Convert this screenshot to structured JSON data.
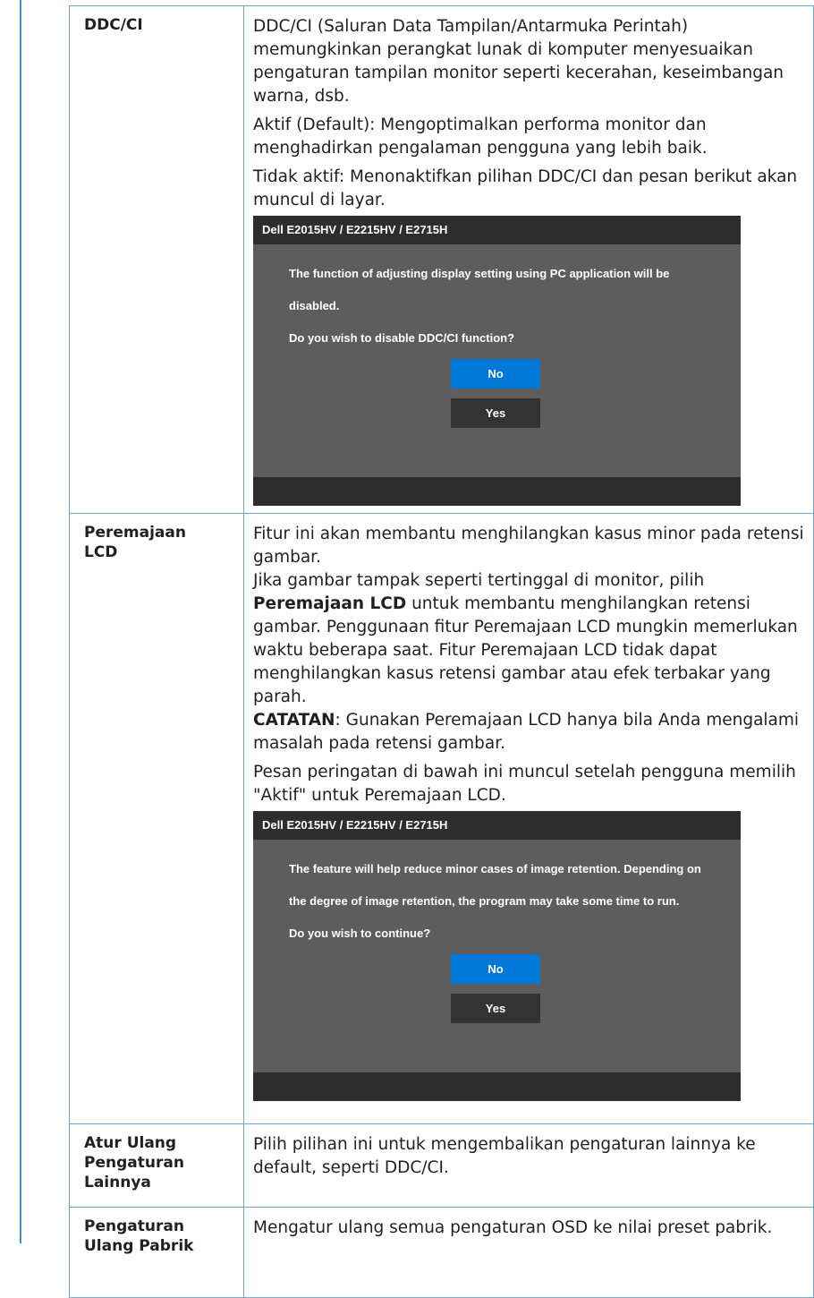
{
  "rows": {
    "ddcci": {
      "label": "DDC/CI",
      "p1": "DDC/CI (Saluran Data Tampilan/Antarmuka Perintah) memungkinkan perangkat lunak di komputer menyesuaikan pengaturan tampilan monitor seperti kecerahan, keseimbangan warna, dsb.",
      "p2": "Aktif (Default): Mengoptimalkan performa monitor dan menghadirkan pengalaman pengguna yang lebih baik.",
      "p3": "Tidak aktif: Menonaktifkan pilihan DDC/CI dan pesan berikut akan muncul di layar.",
      "dialog": {
        "title": "Dell E2015HV / E2215HV / E2715H",
        "line1": "The function of adjusting display setting using PC application will be",
        "line2": "disabled.",
        "line3": "Do you wish to disable DDC/CI function?",
        "no_label": "No",
        "yes_label": "Yes"
      }
    },
    "lcd": {
      "label_line1": "Peremajaan",
      "label_line2": "LCD",
      "p1": "Fitur ini akan membantu menghilangkan kasus minor pada retensi gambar.",
      "p2_pre": "Jika gambar tampak seperti tertinggal di monitor, pilih ",
      "p2_bold": "Peremajaan LCD",
      "p2_post": " untuk membantu menghilangkan retensi gambar. Penggunaan fitur Peremajaan LCD mungkin memerlukan waktu beberapa saat. Fitur Peremajaan LCD tidak dapat menghilangkan kasus retensi gambar atau efek terbakar yang parah.",
      "note_bold": "CATATAN",
      "note_text": ": Gunakan Peremajaan LCD hanya bila Anda mengalami masalah pada retensi gambar.",
      "p4": "Pesan peringatan di bawah ini muncul setelah pengguna memilih \"Aktif\" untuk Peremajaan LCD.",
      "dialog": {
        "title": "Dell E2015HV / E2215HV / E2715H",
        "line1": "The feature will help reduce minor cases of image retention. Depending on",
        "line2": "the degree of image retention, the program may take some time to run.",
        "line3": "Do you wish to continue?",
        "no_label": "No",
        "yes_label": "Yes"
      }
    },
    "reset_other": {
      "label_line1": "Atur Ulang",
      "label_line2": "Pengaturan",
      "label_line3": "Lainnya",
      "desc": "Pilih pilihan ini untuk mengembalikan pengaturan lainnya ke default, seperti DDC/CI."
    },
    "factory": {
      "label_line1": "Pengaturan",
      "label_line2": "Ulang Pabrik",
      "desc": "Mengatur ulang semua pengaturan OSD ke nilai preset pabrik."
    }
  }
}
